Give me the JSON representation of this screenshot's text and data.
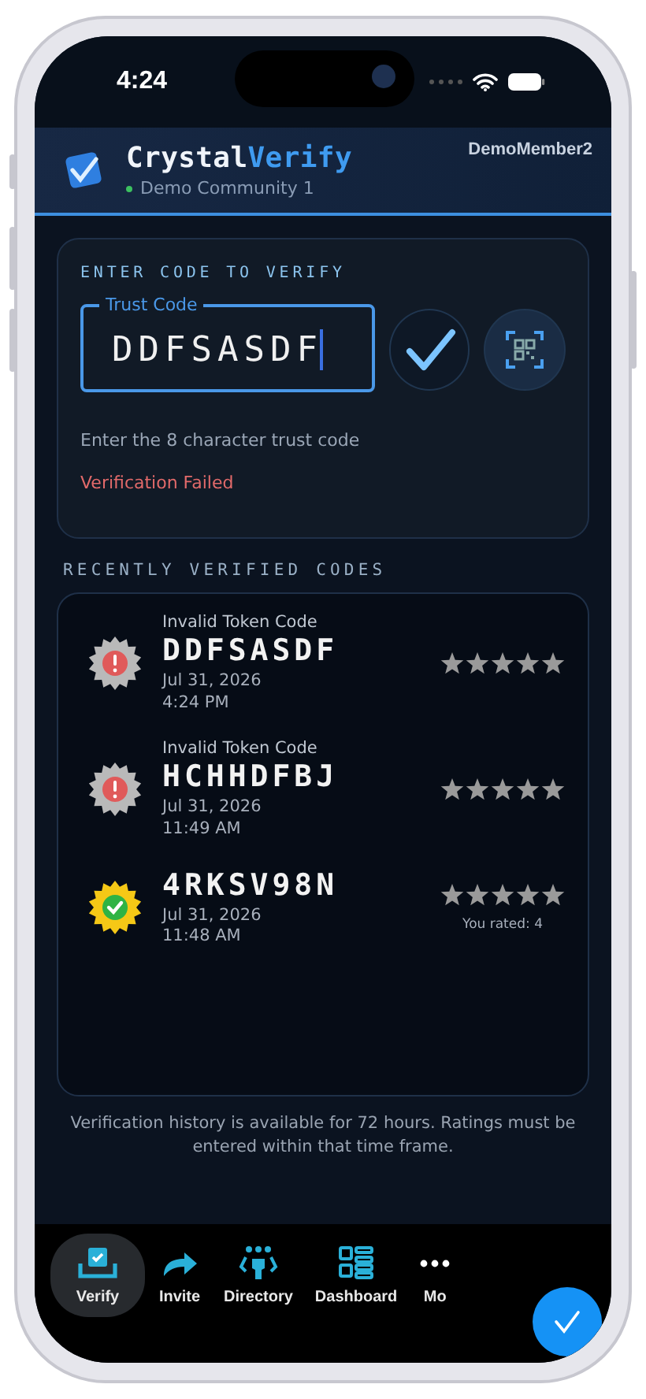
{
  "status_bar": {
    "time": "4:24"
  },
  "header": {
    "brand": "Crystal",
    "brand_accent": "Verify",
    "community": "Demo Community 1",
    "community_online": true,
    "user": "DemoMember2"
  },
  "verify_card": {
    "heading": "ENTER CODE TO VERIFY",
    "field_label": "Trust Code",
    "value": "DDFSASDF",
    "hint": "Enter the 8 character trust code",
    "error": "Verification Failed"
  },
  "history": {
    "heading": "RECENTLY VERIFIED CODES",
    "items": [
      {
        "label": "Invalid Token Code",
        "code": "DDFSASDF",
        "date": "Jul 31, 2026",
        "time": "4:24 PM",
        "kind": "invalid"
      },
      {
        "label": "Invalid Token Code",
        "code": "HCHHDFBJ",
        "date": "Jul 31, 2026",
        "time": "11:49 AM",
        "kind": "invalid"
      },
      {
        "code": "4RKSV98N",
        "date": "Jul 31, 2026",
        "time": "11:48 AM",
        "kind": "valid",
        "rating_note": "You rated: 4"
      }
    ]
  },
  "note": "Verification history is available for 72 hours.  Ratings must be entered within that time frame.",
  "nav": [
    {
      "label": "Verify",
      "kind": "verify",
      "selected": true
    },
    {
      "label": "Invite",
      "kind": "invite",
      "selected": false
    },
    {
      "label": "Directory",
      "kind": "directory",
      "selected": false
    },
    {
      "label": "Dashboard",
      "kind": "dashboard",
      "selected": false
    },
    {
      "label": "Mo",
      "kind": "more",
      "selected": false
    }
  ]
}
